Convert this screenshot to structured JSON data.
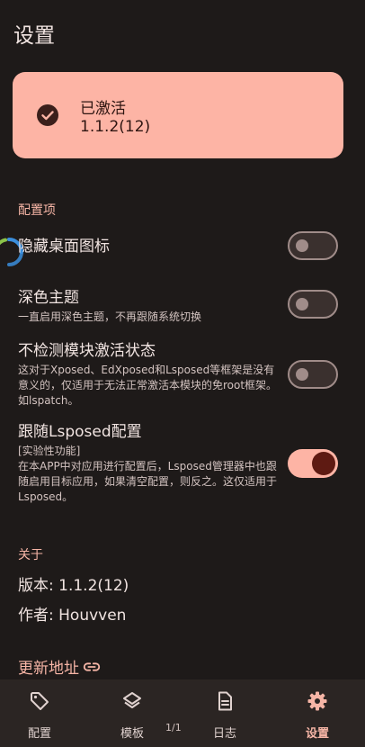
{
  "app_bar": {
    "title": "设置"
  },
  "status": {
    "title": "已激活",
    "version": "1.1.2(12)"
  },
  "config_section": {
    "label": "配置项",
    "items": [
      {
        "title": "隐藏桌面图标",
        "summary": "",
        "enabled": false
      },
      {
        "title": "深色主题",
        "summary": "一直启用深色主题，不再跟随系统切换",
        "enabled": false
      },
      {
        "title": "不检测模块激活状态",
        "summary": "这对于Xposed、EdXposed和Lsposed等框架是没有意义的，仅适用于无法正常激活本模块的免root框架。如lspatch。",
        "enabled": false
      },
      {
        "title": "跟随Lsposed配置",
        "summary_tag": "[实验性功能]",
        "summary": "在本APP中对应用进行配置后，Lsposed管理器中也跟随启用目标应用，如果清空配置，则反之。这仅适用于Lsposed。",
        "enabled": true
      }
    ]
  },
  "about_section": {
    "label": "关于",
    "version_line": "版本: 1.1.2(12)",
    "author_line": "作者: Houvven",
    "update_link": "更新地址"
  },
  "bottom_nav": {
    "items": [
      {
        "label": "配置",
        "icon": "tag-icon"
      },
      {
        "label": "模板",
        "icon": "layers-icon"
      },
      {
        "label": "日志",
        "icon": "document-icon"
      },
      {
        "label": "设置",
        "icon": "gear-icon",
        "active": true
      }
    ],
    "page_indicator": "1/1"
  },
  "colors": {
    "background": "#1e1a19",
    "accent": "#fdb4a5",
    "on_accent": "#5e1a12",
    "section_label": "#f6b5a6"
  }
}
